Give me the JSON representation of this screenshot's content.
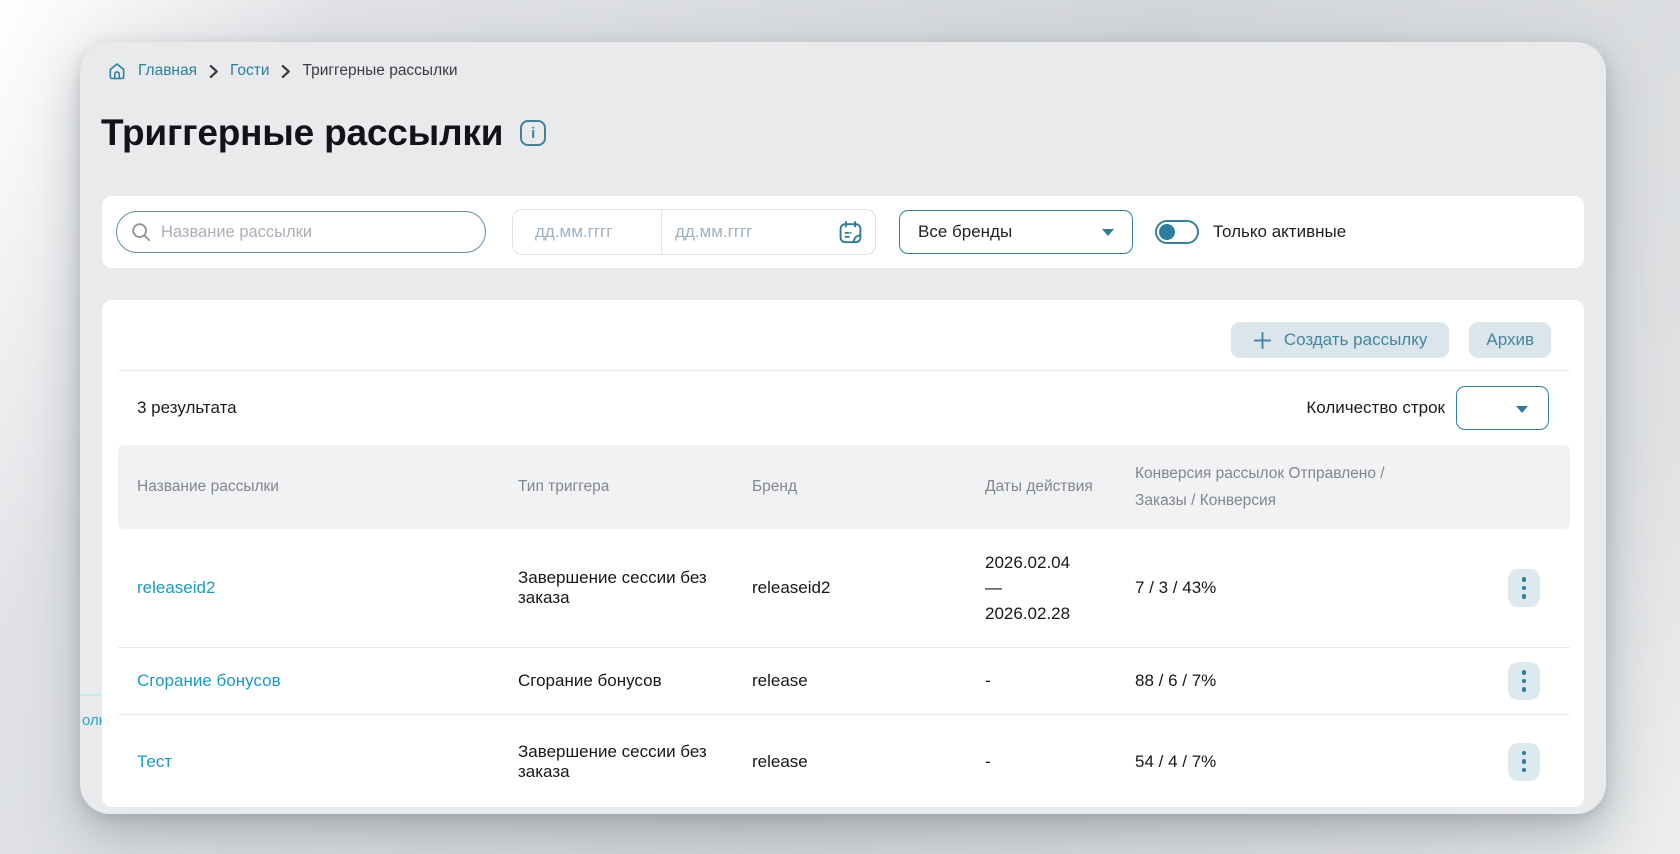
{
  "breadcrumb": {
    "items": [
      {
        "label": "Главная"
      },
      {
        "label": "Гости"
      },
      {
        "label": "Триггерные рассылки"
      }
    ]
  },
  "page": {
    "title": "Триггерные рассылки"
  },
  "filters": {
    "search_placeholder": "Название рассылки",
    "date_from_placeholder": "дд.мм.гггг",
    "date_to_placeholder": "дд.мм.гггг",
    "brand_select_value": "Все бренды",
    "active_toggle_label": "Только активные",
    "active_toggle_state": "off"
  },
  "toolbar": {
    "create_label": "Создать рассылку",
    "archive_label": "Архив"
  },
  "results": {
    "count_label": "3 результата",
    "rows_per_page_label": "Количество строк",
    "rows_per_page_value": ""
  },
  "table": {
    "headers": [
      "Название рассылки",
      "Тип триггера",
      "Бренд",
      "Даты действия",
      "Конверсия рассылок Отправлено /\nЗаказы / Конверсия"
    ],
    "rows": [
      {
        "name": "releaseid2",
        "trigger": "Завершение сессии без заказа",
        "brand": "releaseid2",
        "dates": "2026.02.04\n—\n2026.02.28",
        "conversion": "7 / 3 / 43%"
      },
      {
        "name": "Сгорание бонусов",
        "trigger": "Сгорание бонусов",
        "brand": "release",
        "dates": "-",
        "conversion": "88 / 6 / 7%"
      },
      {
        "name": "Тест",
        "trigger": "Завершение сессии без заказа",
        "brand": "release",
        "dates": "-",
        "conversion": "54 / 4 / 7%"
      }
    ]
  },
  "artifacts": {
    "clipped_text": "олн"
  },
  "icons": {
    "info_glyph": "i",
    "home": "house-outline",
    "breadcrumb_separator": "chevron-right",
    "search": "magnifier",
    "calendar": "calendar",
    "brand_caret": "triangle-down",
    "rows_caret": "triangle-down",
    "plus": "plus",
    "row_menu": "vertical-dots"
  },
  "colors": {
    "accent": "#2e7d9c",
    "link": "#1b9ac4",
    "button_bg": "#dbe6ec",
    "table_header_bg": "#f1f2f4",
    "window_bg": "#e8eaec"
  }
}
